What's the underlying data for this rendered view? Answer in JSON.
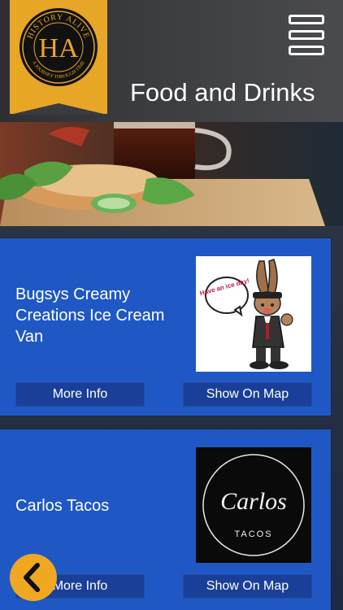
{
  "header": {
    "title": "Food and Drinks",
    "logo": {
      "monogram": "HA",
      "arc_top": "HISTORY ALIVE",
      "arc_bottom": "A JOURNEY THROUGH TIME"
    },
    "menu_icon": "hamburger-icon",
    "ribbon_color": "#e8a627"
  },
  "listings": [
    {
      "name": "Bugsys Creamy Creations Ice Cream Van",
      "image_text": "Have an ice day!",
      "more_info_label": "More Info",
      "show_on_map_label": "Show On Map"
    },
    {
      "name": "Carlos Tacos",
      "image_text": "Carlos",
      "image_subtext": "TACOS",
      "more_info_label": "More Info",
      "show_on_map_label": "Show On Map"
    }
  ],
  "back_icon": "chevron-left-icon",
  "colors": {
    "card": "#1f58c4",
    "button": "#1a3f99",
    "accent": "#f0a823"
  }
}
